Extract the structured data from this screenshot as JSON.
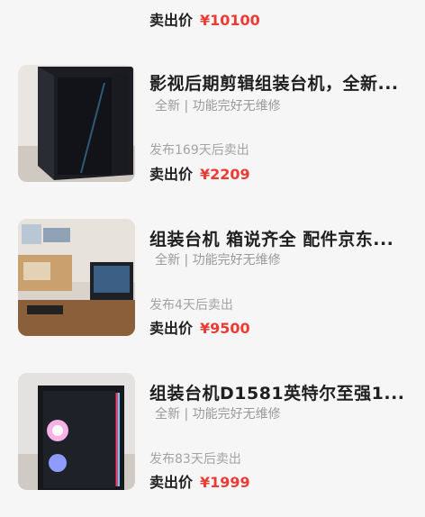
{
  "listings": [
    {
      "title": "",
      "tags": "",
      "days_label": "",
      "sold_label": "卖出价",
      "price": "¥10100"
    },
    {
      "title": "影视后期剪辑组装台机，全新...",
      "tags": "全新 | 功能完好无维修",
      "days_label": "发布169天后卖出",
      "sold_label": "卖出价",
      "price": "¥2209"
    },
    {
      "title": "组装台机 箱说齐全 配件京东...",
      "tags": "全新 | 功能完好无维修",
      "days_label": "发布4天后卖出",
      "sold_label": "卖出价",
      "price": "¥9500"
    },
    {
      "title": "组装台机D1581英特尔至强1...",
      "tags": "全新 | 功能完好无维修",
      "days_label": "发布83天后卖出",
      "sold_label": "卖出价",
      "price": "¥1999"
    }
  ],
  "colors": {
    "price": "#ec3b35",
    "background": "#f6f6f6"
  }
}
